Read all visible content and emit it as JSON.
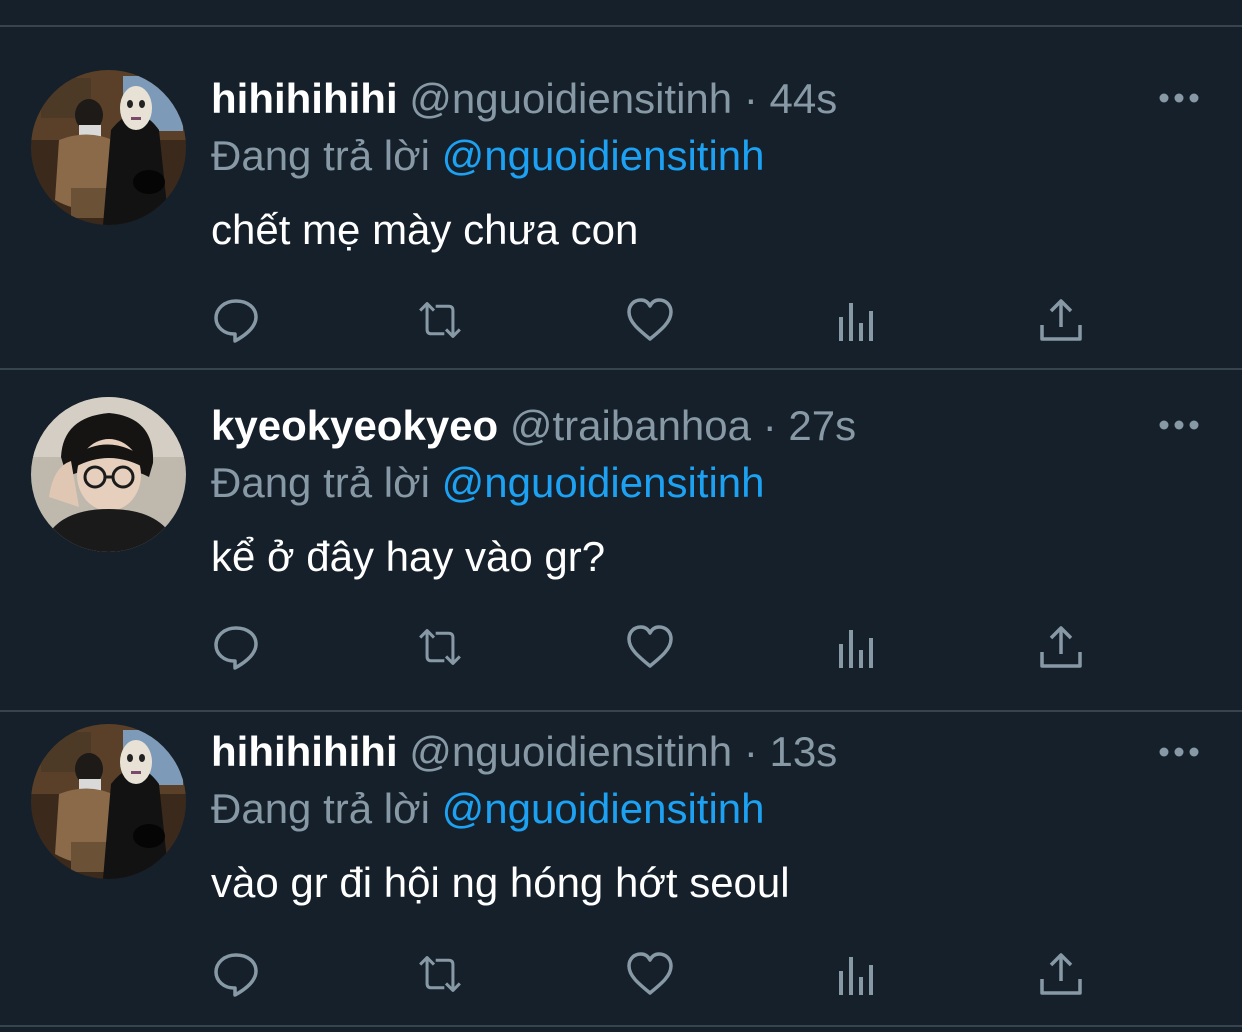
{
  "tweets": [
    {
      "display_name": "hihihihihi",
      "handle": "@nguoidiensitinh",
      "separator": "·",
      "time": "44s",
      "reply_prefix": "Đang trả lời",
      "reply_to": "@nguoidiensitinh",
      "text": "chết mẹ mày chưa con",
      "avatar": "photo-person-with-masked-figure"
    },
    {
      "display_name": "kyeokyeokyeo",
      "handle": "@traibanhoa",
      "separator": "·",
      "time": "27s",
      "reply_prefix": "Đang trả lời",
      "reply_to": "@nguoidiensitinh",
      "text": "kể ở đây hay vào gr?",
      "avatar": "photo-person-with-glasses"
    },
    {
      "display_name": "hihihihihi",
      "handle": "@nguoidiensitinh",
      "separator": "·",
      "time": "13s",
      "reply_prefix": "Đang trả lời",
      "reply_to": "@nguoidiensitinh",
      "text": "vào gr đi hội ng hóng hớt seoul",
      "avatar": "photo-person-with-masked-figure"
    }
  ],
  "icons": {
    "more": "more-horizontal-icon",
    "reply": "reply-bubble-icon",
    "retweet": "retweet-icon",
    "like": "heart-icon",
    "analytics": "analytics-bars-icon",
    "share": "share-upload-icon"
  },
  "colors": {
    "background": "#15202b",
    "divider": "#38444d",
    "primary_text": "#ffffff",
    "secondary_text": "#8899a6",
    "link": "#1da1f2"
  }
}
